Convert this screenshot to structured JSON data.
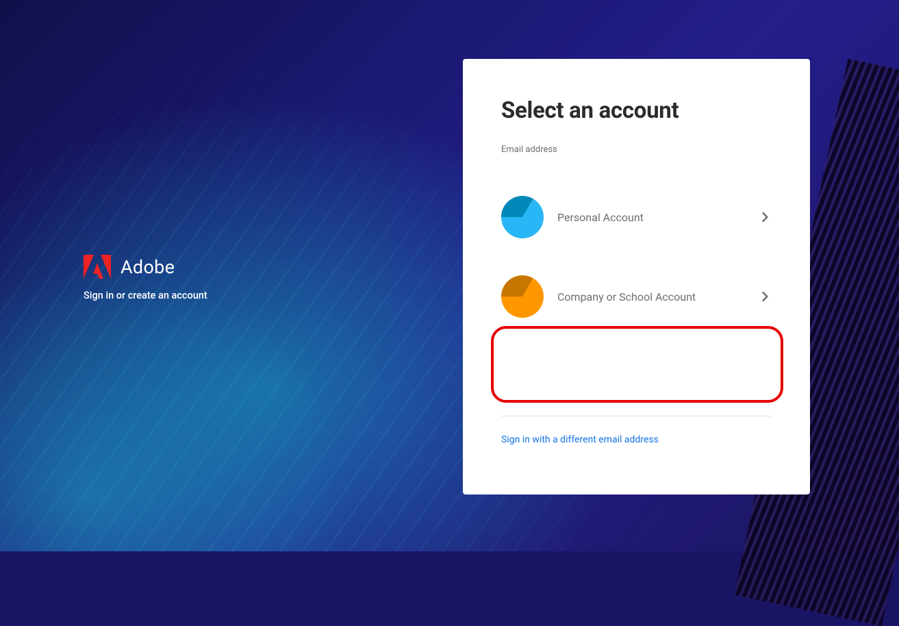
{
  "brand": {
    "name": "Adobe",
    "tagline": "Sign in or create an account"
  },
  "card": {
    "title": "Select an account",
    "subtitle": "Email address",
    "options": [
      {
        "label": "Personal Account",
        "icon": "blue"
      },
      {
        "label": "Company or School Account",
        "icon": "orange"
      }
    ],
    "alt_link": "Sign in with a different email address"
  },
  "annotation": {
    "highlight_option_index": 1,
    "highlight_color": "#e60000"
  }
}
